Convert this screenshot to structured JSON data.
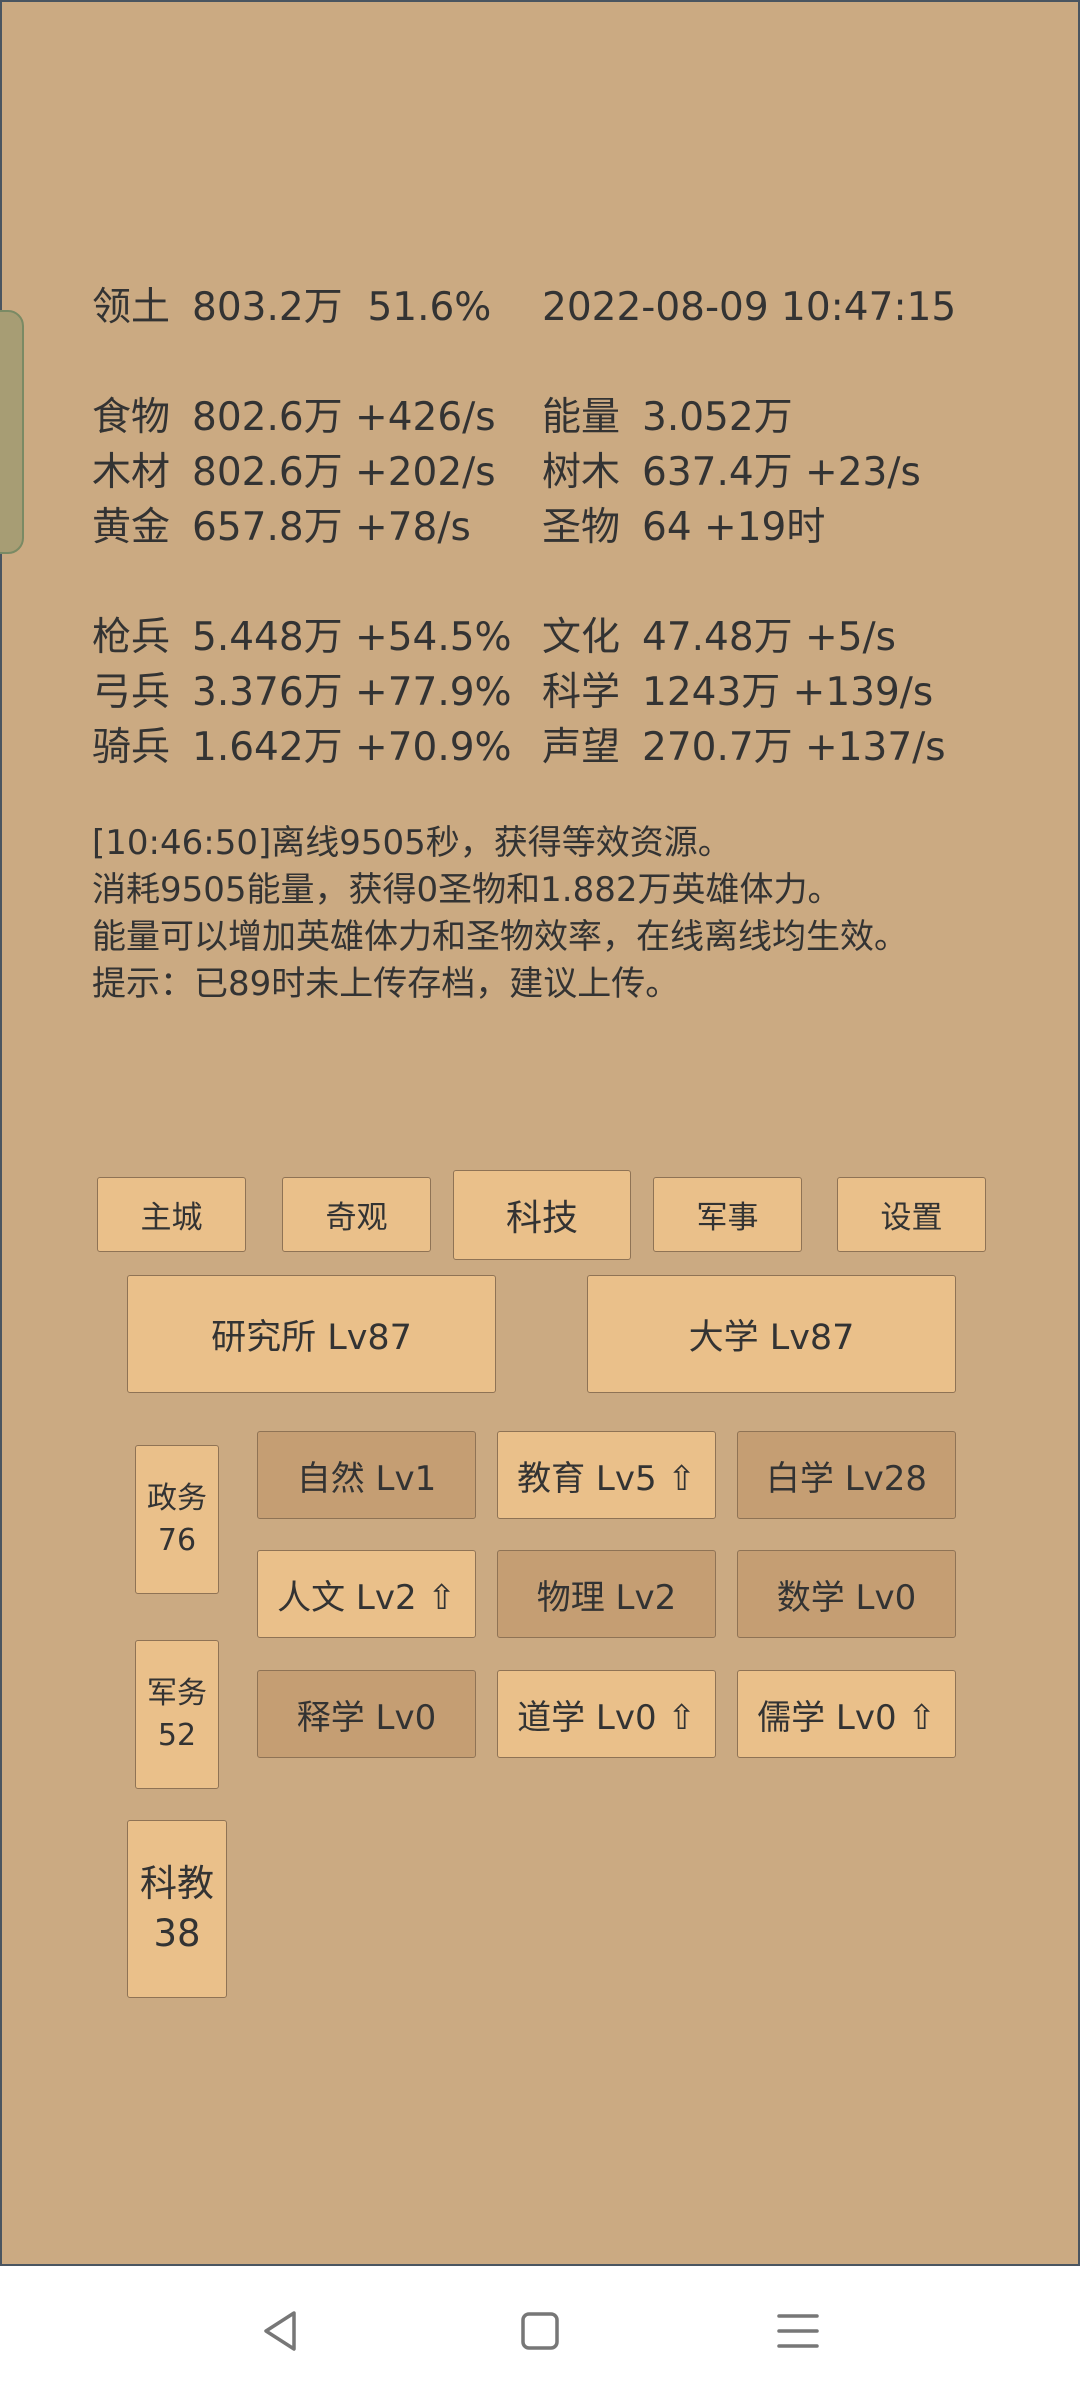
{
  "stats": {
    "territory": {
      "label": "领土",
      "value": "803.2万",
      "pct": "51.6%"
    },
    "datetime": "2022-08-09 10:47:15",
    "left_resources": [
      {
        "label": "食物",
        "value": "802.6万 +426/s"
      },
      {
        "label": "木材",
        "value": "802.6万 +202/s"
      },
      {
        "label": "黄金",
        "value": "657.8万 +78/s"
      }
    ],
    "right_resources": [
      {
        "label": "能量",
        "value": "3.052万"
      },
      {
        "label": "树木",
        "value": "637.4万 +23/s"
      },
      {
        "label": "圣物",
        "value": "64 +19时"
      }
    ],
    "troops": [
      {
        "label": "枪兵",
        "value": "5.448万 +54.5%"
      },
      {
        "label": "弓兵",
        "value": "3.376万 +77.9%"
      },
      {
        "label": "骑兵",
        "value": "1.642万 +70.9%"
      }
    ],
    "culture": [
      {
        "label": "文化",
        "value": "47.48万 +5/s"
      },
      {
        "label": "科学",
        "value": "1243万 +139/s"
      },
      {
        "label": "声望",
        "value": "270.7万 +137/s"
      }
    ]
  },
  "log": [
    "[10:46:50]离线9505秒，获得等效资源。",
    "消耗9505能量，获得0圣物和1.882万英雄体力。",
    "能量可以增加英雄体力和圣物效率，在线离线均生效。",
    "提示：已89时未上传存档，建议上传。"
  ],
  "nav": {
    "tabs": [
      "主城",
      "奇观",
      "科技",
      "军事",
      "设置"
    ],
    "active": "科技"
  },
  "buildings": [
    "研究所 Lv87",
    "大学 Lv87"
  ],
  "categories": [
    {
      "name": "政务",
      "value": "76"
    },
    {
      "name": "军务",
      "value": "52"
    },
    {
      "name": "科教",
      "value": "38"
    }
  ],
  "techs": [
    {
      "label": "自然 Lv1",
      "style": "dim"
    },
    {
      "label": "教育 Lv5 ⇧",
      "style": "light"
    },
    {
      "label": "白学 Lv28",
      "style": "dim"
    },
    {
      "label": "人文 Lv2 ⇧",
      "style": "light"
    },
    {
      "label": "物理 Lv2",
      "style": "dim"
    },
    {
      "label": "数学 Lv0",
      "style": "dim"
    },
    {
      "label": "释学 Lv0",
      "style": "dim"
    },
    {
      "label": "道学 Lv0 ⇧",
      "style": "light"
    },
    {
      "label": "儒学 Lv0 ⇧",
      "style": "light"
    }
  ],
  "system_nav": [
    "back-icon",
    "home-icon",
    "menu-icon"
  ]
}
